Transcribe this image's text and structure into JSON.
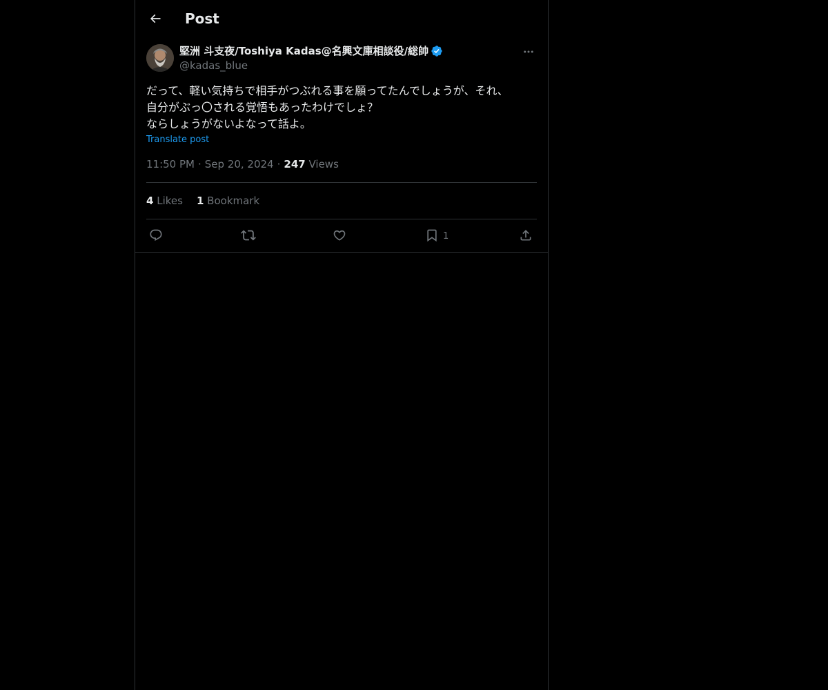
{
  "header": {
    "title": "Post"
  },
  "post": {
    "author": {
      "display_name": "堅洲 斗支夜/Toshiya Kadas@名興文庫相談役/総帥",
      "handle": "@kadas_blue",
      "verified": true
    },
    "text_lines": [
      "だって、軽い気持ちで相手がつぶれる事を願ってたんでしょうが、それ、",
      "自分がぶっ〇される覚悟もあったわけでしょ？",
      "ならしょうがないよなって話よ。"
    ],
    "translate_label": "Translate post",
    "time": "11:50 PM",
    "date": "Sep 20, 2024",
    "views_count": "247",
    "views_label": "Views",
    "likes_count": "4",
    "likes_label": "Likes",
    "bookmarks_count": "1",
    "bookmarks_label": "Bookmark"
  },
  "actions": {
    "reply_icon": "reply-icon",
    "repost_icon": "repost-icon",
    "like_icon": "heart-icon",
    "bookmark_icon": "bookmark-icon",
    "bookmark_count": "1",
    "share_icon": "share-icon"
  },
  "colors": {
    "background": "#000000",
    "text": "#e7e9ea",
    "secondary_text": "#71767b",
    "accent": "#1d9bf0",
    "border": "#2f3336"
  }
}
